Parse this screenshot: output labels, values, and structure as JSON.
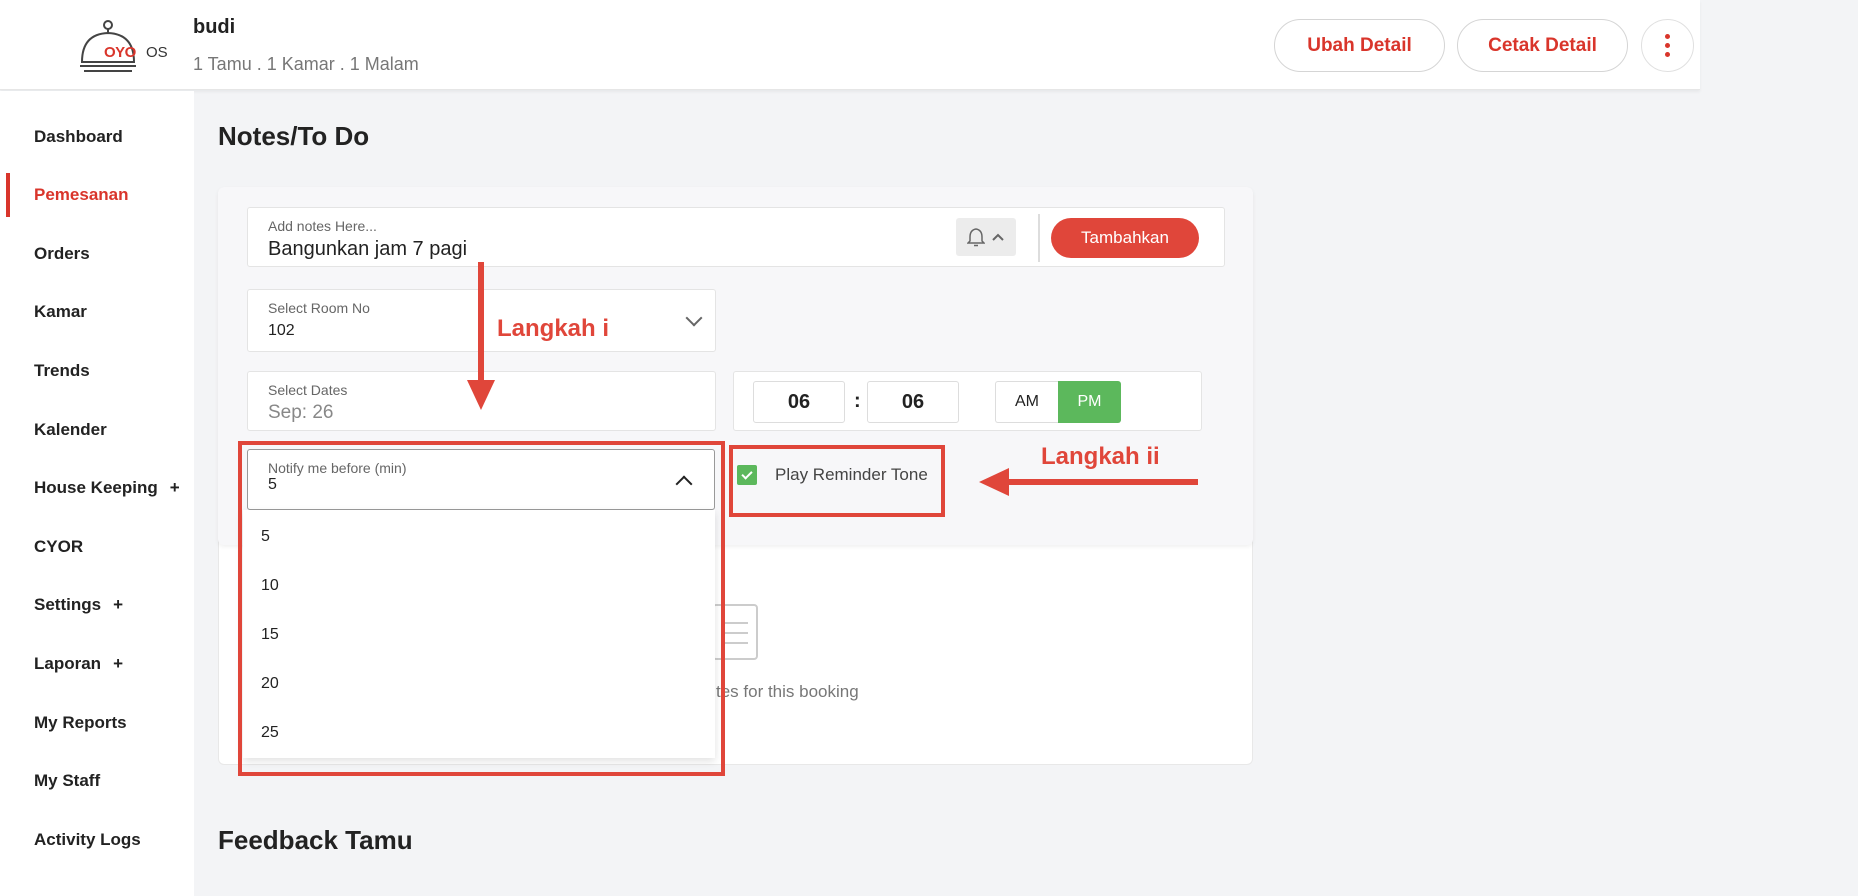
{
  "header": {
    "logo_text": "OYO",
    "logo_suffix": "OS",
    "guest_name": "budi",
    "guest_summary": "1 Tamu . 1 Kamar . 1 Malam",
    "edit_button": "Ubah Detail",
    "print_button": "Cetak Detail",
    "more_icon": "more-vertical-icon"
  },
  "sidebar": {
    "items": [
      {
        "label": "Dashboard"
      },
      {
        "label": "Pemesanan",
        "active": true
      },
      {
        "label": "Orders"
      },
      {
        "label": "Kamar"
      },
      {
        "label": "Trends"
      },
      {
        "label": "Kalender"
      },
      {
        "label": "House Keeping",
        "expand": "+"
      },
      {
        "label": "CYOR"
      },
      {
        "label": "Settings",
        "expand": "+"
      },
      {
        "label": "Laporan",
        "expand": "+"
      },
      {
        "label": "My Reports"
      },
      {
        "label": "My Staff"
      },
      {
        "label": "Activity Logs"
      }
    ]
  },
  "notes": {
    "title": "Notes/To Do",
    "input_label": "Add notes Here...",
    "input_value": "Bangunkan jam 7 pagi",
    "add_button": "Tambahkan",
    "room": {
      "label": "Select Room No",
      "value": "102"
    },
    "dates": {
      "label": "Select Dates",
      "value": "Sep: 26"
    },
    "time": {
      "hour": "06",
      "separator": ":",
      "minute": "06",
      "am": "AM",
      "pm": "PM",
      "selected": "PM"
    },
    "notify": {
      "label": "Notify me before (min)",
      "value": "5",
      "options": [
        "5",
        "10",
        "15",
        "20",
        "25"
      ]
    },
    "reminder": {
      "label": "Play Reminder Tone",
      "checked": true
    },
    "empty_text": "tes for this booking"
  },
  "feedback": {
    "title": "Feedback Tamu"
  },
  "annotations": {
    "step1": "Langkah i",
    "step2": "Langkah ii",
    "color": "#e0463a"
  },
  "colors": {
    "brand": "#d9352b",
    "accent_green": "#5cb85c",
    "add_button": "#e0463a"
  }
}
